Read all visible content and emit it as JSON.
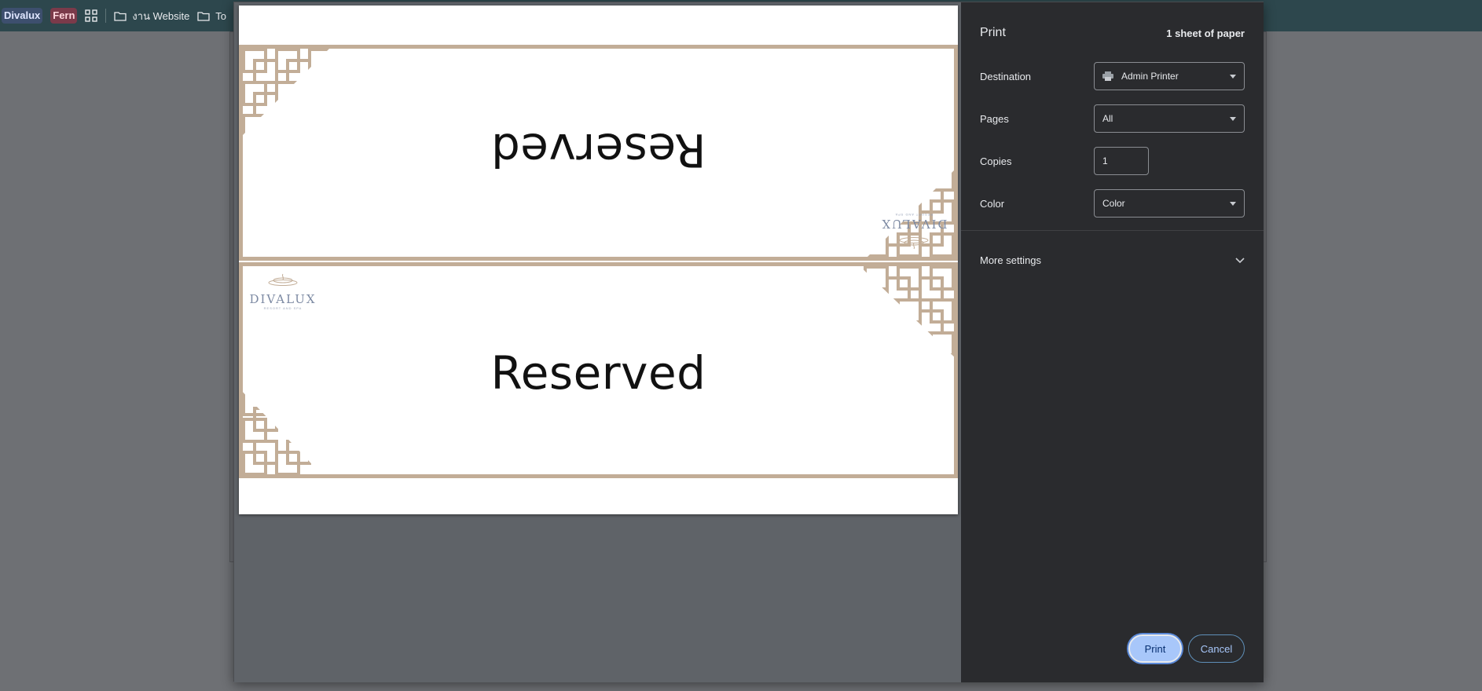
{
  "bookmarks": {
    "chip1": "Divalux",
    "chip2": "Fern",
    "folder1": "งาน Website",
    "folder2": "To"
  },
  "preview": {
    "card_text": "Reserved",
    "logo_text": "DIVALUX",
    "logo_sub": "RESORT AND SPA"
  },
  "print": {
    "title": "Print",
    "sheets": "1 sheet of paper",
    "destination_label": "Destination",
    "destination_value": "Admin Printer",
    "pages_label": "Pages",
    "pages_value": "All",
    "copies_label": "Copies",
    "copies_value": "1",
    "color_label": "Color",
    "color_value": "Color",
    "more_settings": "More settings",
    "print_button": "Print",
    "cancel_button": "Cancel"
  },
  "colors": {
    "panel_bg": "#2a2b2e",
    "accent": "#a8c7fa",
    "frame": "#c2ad97",
    "bookmarks_bar": "#2d474d"
  }
}
